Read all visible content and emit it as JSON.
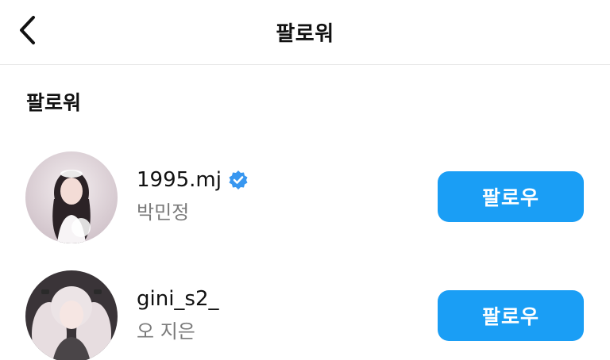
{
  "header": {
    "back_icon": "chevron-left-icon",
    "title": "팔로워"
  },
  "section": {
    "title": "팔로워"
  },
  "followers": [
    {
      "username": "1995.mj",
      "verified": true,
      "full_name": "박민정",
      "button_label": "팔로우"
    },
    {
      "username": "gini_s2_",
      "verified": false,
      "full_name": "오 지은",
      "button_label": "팔로우"
    }
  ],
  "colors": {
    "accent": "#1a9ef5",
    "verified": "#3897f0",
    "secondary_text": "#7a7a7a"
  }
}
